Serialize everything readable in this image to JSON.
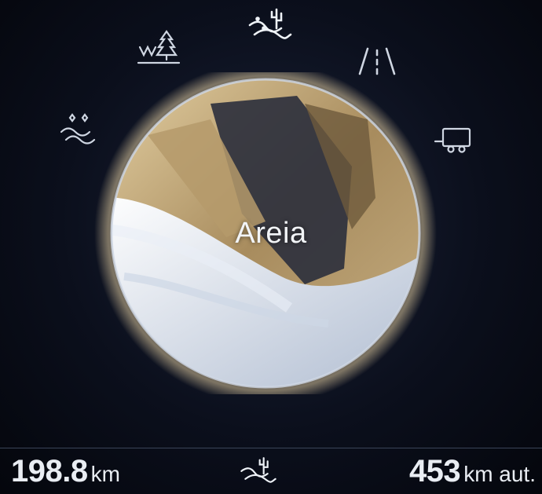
{
  "drive_mode": {
    "current_label": "Areia",
    "icons": [
      {
        "name": "snow-mode-icon",
        "state": "inactive"
      },
      {
        "name": "snow-forest-mode-icon",
        "state": "inactive"
      },
      {
        "name": "sand-desert-mode-icon",
        "state": "active"
      },
      {
        "name": "road-mode-icon",
        "state": "inactive"
      },
      {
        "name": "tow-trailer-mode-icon",
        "state": "inactive"
      }
    ]
  },
  "trip": {
    "distance": "198.8",
    "unit": "km"
  },
  "range": {
    "distance": "453",
    "unit": "km aut."
  },
  "bottom_icon": "sand-desert-mode-icon",
  "colors": {
    "background": "#0b0f1c",
    "sand": "#c9b286",
    "snow": "#dde6f2",
    "text": "#e9edf3"
  }
}
